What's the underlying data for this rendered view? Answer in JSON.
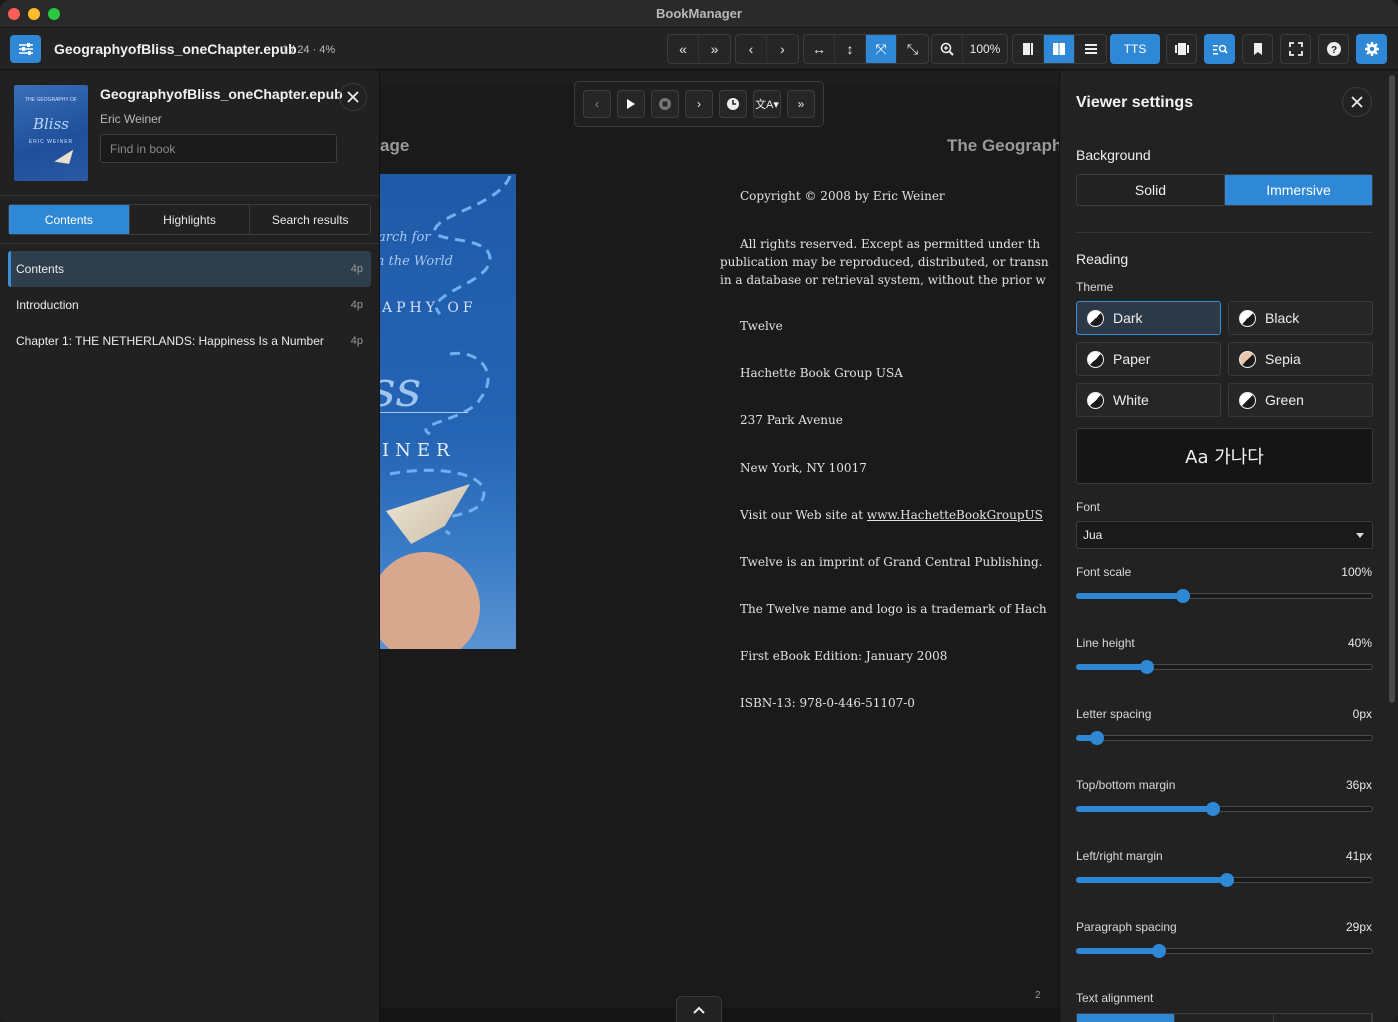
{
  "window": {
    "title": "BookManager"
  },
  "toolbar": {
    "file_name": "GeographyofBliss_oneChapter.epub",
    "page_info": "1 / 24 · 4%",
    "zoom": "100%",
    "tts_label": "TTS",
    "accent": "#2e88d6"
  },
  "book": {
    "title": "GeographyofBliss_oneChapter.epub",
    "author": "Eric Weiner",
    "find_placeholder": "Find in book",
    "cover_text": {
      "title": "Bliss",
      "author": "ERIC WEINER"
    }
  },
  "sidebar": {
    "tabs": [
      {
        "label": "Contents",
        "active": true
      },
      {
        "label": "Highlights",
        "active": false
      },
      {
        "label": "Search results",
        "active": false
      }
    ],
    "toc": [
      {
        "label": "Contents",
        "pages": "4p",
        "active": true
      },
      {
        "label": "Introduction",
        "pages": "4p",
        "active": false
      },
      {
        "label": "Chapter 1: THE NETHERLANDS: Happiness Is a Number",
        "pages": "4p",
        "active": false
      }
    ]
  },
  "reader": {
    "header_left": "age",
    "header_right": "The Geograph",
    "cover_lines": [
      "arch for",
      "n the World",
      "APHY OF",
      "ss",
      "INER"
    ],
    "copyright_line": "Copyright © 2008 by Eric Weiner",
    "rights_lines": [
      "All rights reserved. Except as permitted under th",
      "publication may be reproduced, distributed, or transn",
      "in a database or retrieval system, without the prior w"
    ],
    "lines": [
      "Twelve",
      "Hachette Book Group USA",
      "237 Park Avenue",
      "New York, NY 10017",
      "Visit our Web site at www.HachetteBookGroupUS",
      "Twelve is an imprint of Grand Central Publishing.",
      "The Twelve name and logo is a trademark of Hach",
      "First eBook Edition: January 2008",
      "ISBN-13: 978-0-446-51107-0"
    ],
    "page_number": "2"
  },
  "settings": {
    "title": "Viewer settings",
    "background_label": "Background",
    "background_options": [
      {
        "label": "Solid",
        "active": false
      },
      {
        "label": "Immersive",
        "active": true
      }
    ],
    "reading_label": "Reading",
    "theme_label": "Theme",
    "themes": [
      {
        "label": "Dark",
        "active": true,
        "icon": "theme-dot"
      },
      {
        "label": "Black",
        "active": false,
        "icon": "theme-dot"
      },
      {
        "label": "Paper",
        "active": false,
        "icon": "theme-dot"
      },
      {
        "label": "Sepia",
        "active": false,
        "icon": "theme-dot-sepia"
      },
      {
        "label": "White",
        "active": false,
        "icon": "theme-dot"
      },
      {
        "label": "Green",
        "active": false,
        "icon": "theme-dot"
      }
    ],
    "preview_text": "Aa 가나다",
    "font_label": "Font",
    "font_value": "Jua",
    "sliders": [
      {
        "label": "Font scale",
        "value": "100%",
        "fraction": 0.36
      },
      {
        "label": "Line height",
        "value": "40%",
        "fraction": 0.24
      },
      {
        "label": "Letter spacing",
        "value": "0px",
        "fraction": 0.07
      },
      {
        "label": "Top/bottom margin",
        "value": "36px",
        "fraction": 0.46
      },
      {
        "label": "Left/right margin",
        "value": "41px",
        "fraction": 0.51
      },
      {
        "label": "Paragraph spacing",
        "value": "29px",
        "fraction": 0.28
      }
    ],
    "text_alignment_label": "Text alignment"
  }
}
